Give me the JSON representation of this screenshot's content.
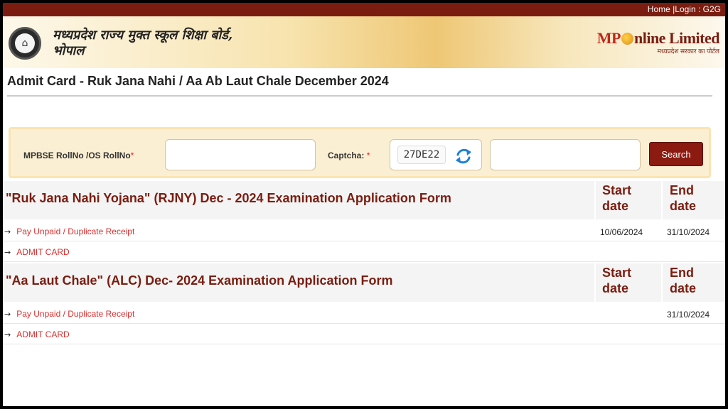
{
  "topnav": {
    "home": "Home",
    "login": "Login",
    "g2g": "G2G"
  },
  "header": {
    "board_name_line1": "मध्यप्रदेश राज्य मुक्त स्कूल शिक्षा बोर्ड,",
    "board_name_line2": "भोपाल",
    "brand_mp": "MP",
    "brand_rest": "nline Limited",
    "brand_tagline": "मध्यप्रदेश सरकार का पोर्टल"
  },
  "page": {
    "title": "Admit Card - Ruk Jana Nahi / Aa Ab Laut Chale December 2024"
  },
  "search": {
    "roll_label": "MPBSE RollNo /OS RollNo",
    "roll_required": "*",
    "roll_value": "",
    "captcha_label": "Captcha: ",
    "captcha_required": "*",
    "captcha_text": "27DE22",
    "captcha_value": "",
    "search_label": "Search"
  },
  "sections": [
    {
      "title": "\"Ruk Jana Nahi Yojana\" (RJNY) Dec - 2024 Examination Application Form",
      "start_head_1": "Start",
      "start_head_2": "date",
      "end_head_1": "End",
      "end_head_2": "date",
      "rows": [
        {
          "label": "Pay Unpaid / Duplicate Receipt",
          "start": "10/06/2024",
          "end": "31/10/2024"
        },
        {
          "label": "ADMIT CARD",
          "start": "",
          "end": ""
        }
      ]
    },
    {
      "title": "\"Aa Laut Chale\" (ALC) Dec- 2024 Examination Application Form",
      "start_head_1": "Start",
      "start_head_2": "date",
      "end_head_1": "End",
      "end_head_2": "date",
      "rows": [
        {
          "label": "Pay Unpaid / Duplicate Receipt",
          "start": "",
          "end": "31/10/2024"
        },
        {
          "label": "ADMIT CARD",
          "start": "",
          "end": ""
        }
      ]
    }
  ],
  "arrow_glyph": "→",
  "colors": {
    "brand_maroon": "#7a1d10",
    "link_red": "#d93030",
    "button": "#8b1a10",
    "panel": "#fbefd3"
  }
}
